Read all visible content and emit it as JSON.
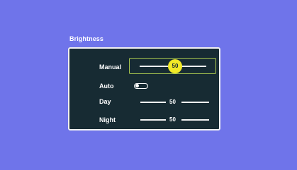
{
  "osd": {
    "title": "Brightness",
    "manual": {
      "label": "Manual",
      "value": "50"
    },
    "auto": {
      "label": "Auto",
      "enabled": false
    },
    "day": {
      "label": "Day",
      "value": "50"
    },
    "night": {
      "label": "Night",
      "value": "50"
    }
  },
  "colors": {
    "background": "#6f74ea",
    "panel": "#172b33",
    "highlight_border": "#a7c54f",
    "knob": "#f1ea27",
    "text": "#ffffff"
  }
}
